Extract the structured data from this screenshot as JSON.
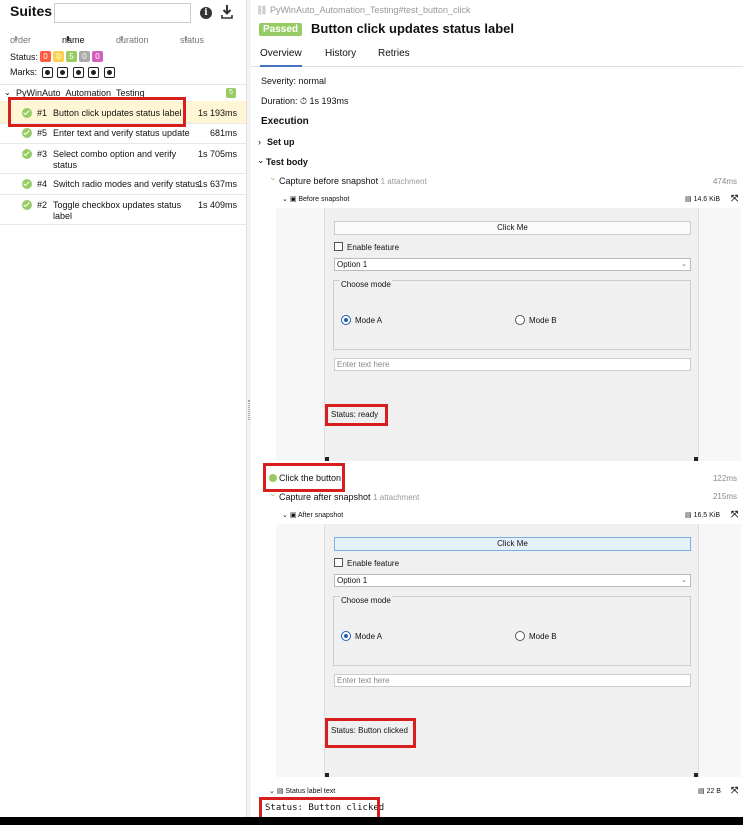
{
  "sidebar": {
    "title": "Suites",
    "search_value": "",
    "sort": {
      "order": "order",
      "name": "name",
      "duration": "duration",
      "status": "status"
    },
    "status_label": "Status:",
    "status_counts": [
      {
        "value": "0",
        "color": "#fd5a3e"
      },
      {
        "value": "0",
        "color": "#ffd050"
      },
      {
        "value": "5",
        "color": "#97cc64"
      },
      {
        "value": "0",
        "color": "#aaaaaa"
      },
      {
        "value": "0",
        "color": "#d35ebe"
      }
    ],
    "marks_label": "Marks:",
    "suite": {
      "name": "PyWinAuto_Automation_Testing",
      "count": "5"
    },
    "tests": [
      {
        "num": "#1",
        "title": "Button click updates status label",
        "duration": "1s 193ms"
      },
      {
        "num": "#5",
        "title": "Enter text and verify status update",
        "duration": "681ms"
      },
      {
        "num": "#3",
        "title": "Select combo option and verify status",
        "duration": "1s 705ms"
      },
      {
        "num": "#4",
        "title": "Switch radio modes and verify status",
        "duration": "1s 637ms"
      },
      {
        "num": "#2",
        "title": "Toggle checkbox updates status label",
        "duration": "1s 409ms"
      }
    ]
  },
  "detail": {
    "breadcrumb": "PyWinAuto_Automation_Testing#test_button_click",
    "status": "Passed",
    "title": "Button click updates status label",
    "tabs": [
      "Overview",
      "History",
      "Retries"
    ],
    "severity": "Severity: normal",
    "duration": "Duration: ⏱ 1s 193ms",
    "execution": "Execution",
    "setup": "Set up",
    "test_body": "Test body",
    "steps": {
      "before": {
        "title": "Capture before snapshot",
        "attach": "1 attachment",
        "time": "474ms",
        "file": "Before snapshot",
        "size": "14.6 KiB"
      },
      "click": {
        "title": "Click the button",
        "time": "122ms"
      },
      "after": {
        "title": "Capture after snapshot",
        "attach": "1 attachment",
        "time": "215ms",
        "file": "After snapshot",
        "size": "16.5 KiB"
      },
      "label": {
        "file": "Status label text",
        "size": "22 B",
        "content": "Status: Button clicked"
      }
    },
    "snapshot": {
      "button": "Click Me",
      "checkbox": "Enable feature",
      "combo": "Option 1",
      "group": "Choose mode",
      "mode_a": "Mode A",
      "mode_b": "Mode B",
      "text_placeholder": "Enter text here",
      "status_before": "Status: ready",
      "status_after": "Status: Button clicked"
    }
  }
}
